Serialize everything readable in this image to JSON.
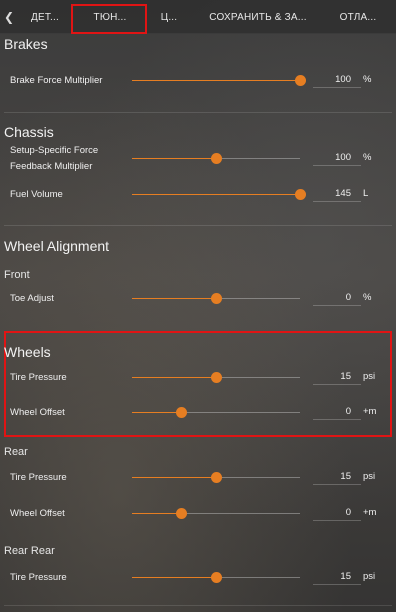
{
  "tabs": [
    {
      "label": "ДЕТ..."
    },
    {
      "label": "ТЮН..."
    },
    {
      "label": "Ц..."
    },
    {
      "label": "СОХРАНИТЬ & ЗА..."
    },
    {
      "label": "ОТЛА..."
    }
  ],
  "active_tab": "ТЮН...",
  "sections": {
    "brakes": {
      "title": "Brakes",
      "brake_force": {
        "label": "Brake Force Multiplier",
        "value": "100",
        "unit": "%",
        "level": 1.0
      }
    },
    "chassis": {
      "title": "Chassis",
      "ffb": {
        "label_line1": "Setup-Specific Force",
        "label_line2": "Feedback Multiplier",
        "value": "100",
        "unit": "%",
        "level": 0.5
      },
      "fuel": {
        "label": "Fuel Volume",
        "value": "145",
        "unit": "L",
        "level": 1.0
      }
    },
    "alignment": {
      "title": "Wheel Alignment",
      "front_title": "Front",
      "toe": {
        "label": "Toe Adjust",
        "value": "0",
        "unit": "%",
        "level": 0.5
      }
    },
    "wheels": {
      "title": "Wheels",
      "tire_pressure": {
        "label": "Tire Pressure",
        "value": "15",
        "unit": "psi",
        "level": 0.5
      },
      "wheel_offset": {
        "label": "Wheel Offset",
        "value": "0",
        "unit": "+m",
        "level": 0.29
      }
    },
    "rear": {
      "title": "Rear",
      "tire_pressure": {
        "label": "Tire Pressure",
        "value": "15",
        "unit": "psi",
        "level": 0.5
      },
      "wheel_offset": {
        "label": "Wheel Offset",
        "value": "0",
        "unit": "+m",
        "level": 0.29
      }
    },
    "rear_rear": {
      "title": "Rear Rear",
      "tire_pressure": {
        "label": "Tire Pressure",
        "value": "15",
        "unit": "psi",
        "level": 0.5
      }
    }
  },
  "colors": {
    "accent": "#e67e22",
    "highlight": "#e01414"
  }
}
